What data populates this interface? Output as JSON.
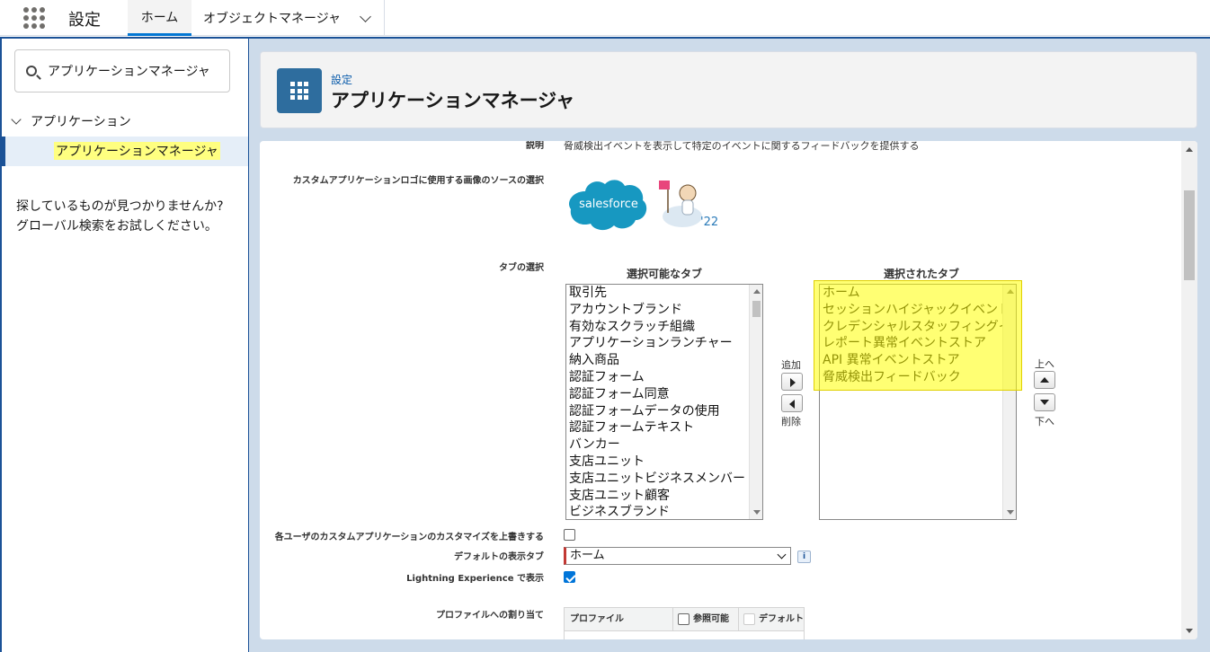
{
  "topnav": {
    "app_name": "設定",
    "tab_home": "ホーム",
    "tab_object_manager": "オブジェクトマネージャ"
  },
  "sidebar": {
    "quick_find_value": "アプリケーションマネージャ",
    "tree_parent": "アプリケーション",
    "tree_child": "アプリケーションマネージャ",
    "not_found_line1": "探しているものが見つかりませんか?",
    "not_found_line2": "グローバル検索をお試しください。"
  },
  "header": {
    "breadcrumb": "設定",
    "title": "アプリケーションマネージャ"
  },
  "form": {
    "description_label": "説明",
    "description_value": "脅威検出イベントを表示して特定のイベントに関するフィードバックを提供する",
    "logo_label": "カスタムアプリケーションロゴに使用する画像のソースの選択",
    "logo_text": "salesforce",
    "logo_year": "'22",
    "tabs_label": "タブの選択",
    "available_title": "選択可能なタブ",
    "selected_title": "選択されたタブ",
    "available_tabs": [
      "取引先",
      "アカウントブランド",
      "有効なスクラッチ組織",
      "アプリケーションランチャー",
      "納入商品",
      "認証フォーム",
      "認証フォーム同意",
      "認証フォームデータの使用",
      "認証フォームテキスト",
      "バンカー",
      "支店ユニット",
      "支店ユニットビジネスメンバー",
      "支店ユニット顧客",
      "ビジネスブランド"
    ],
    "selected_tabs": [
      "ホーム",
      "セッションハイジャックイベントストア",
      "クレデンシャルスタッフィングイベントス",
      "レポート異常イベントストア",
      "API 異常イベントストア",
      "脅威検出フィードバック"
    ],
    "add_label": "追加",
    "remove_label": "削除",
    "up_label": "上へ",
    "down_label": "下へ",
    "override_label": "各ユーザのカスタムアプリケーションのカスタマイズを上書きする",
    "override_checked": false,
    "default_tab_label": "デフォルトの表示タブ",
    "default_tab_value": "ホーム",
    "info_icon_text": "i",
    "lightning_label": "Lightning Experience で表示",
    "lightning_checked": true,
    "profile_label": "プロファイルへの割り当て",
    "profile_col": "プロファイル",
    "visible_col": "参照可能",
    "default_col": "デフォルト"
  },
  "colors": {
    "brand_blue": "#1b5297",
    "highlight": "#ffff00",
    "checkbox_blue": "#0075d9",
    "required_red": "#c23934"
  }
}
